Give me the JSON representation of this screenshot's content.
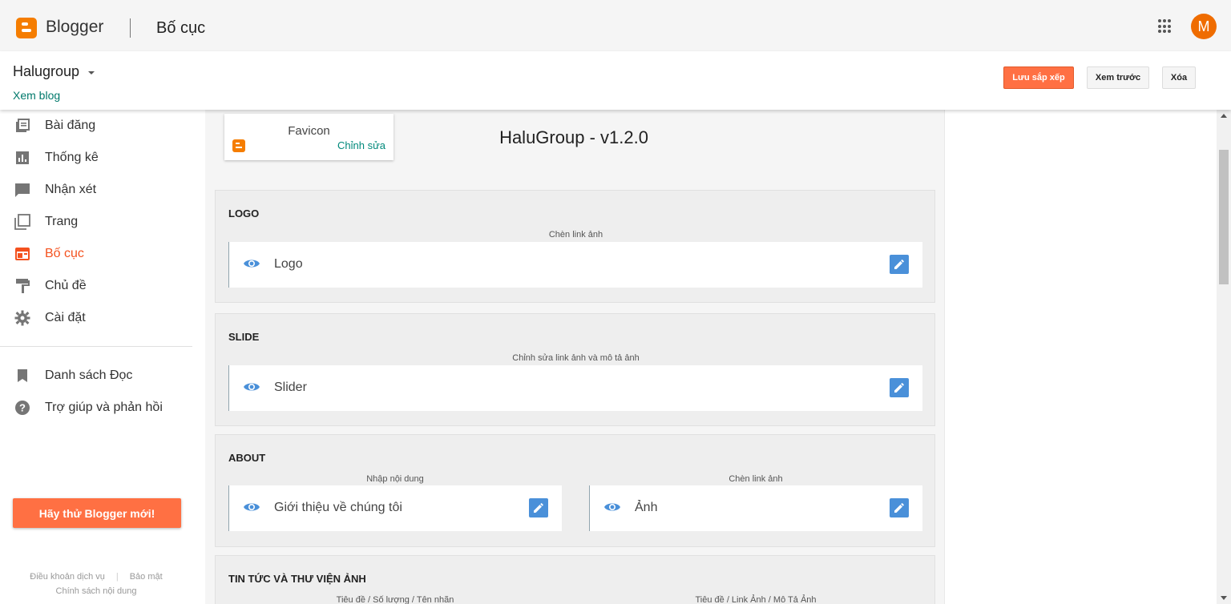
{
  "header": {
    "brand": "Blogger",
    "page_title": "Bố cục",
    "avatar_initial": "M",
    "apps_icon": "apps-grid-icon",
    "accent_color": "#f57d00"
  },
  "blog": {
    "name": "Halugroup",
    "view_link": "Xem blog"
  },
  "toolbar": {
    "save_label": "Lưu sắp xếp",
    "preview_label": "Xem trước",
    "delete_label": "Xóa"
  },
  "sidebar": {
    "items": [
      {
        "label": "Bài đăng",
        "icon": "posts-icon"
      },
      {
        "label": "Thống kê",
        "icon": "stats-icon"
      },
      {
        "label": "Nhận xét",
        "icon": "comments-icon"
      },
      {
        "label": "Trang",
        "icon": "pages-icon"
      },
      {
        "label": "Bố cục",
        "icon": "layout-icon",
        "active": true
      },
      {
        "label": "Chủ đề",
        "icon": "theme-icon"
      },
      {
        "label": "Cài đặt",
        "icon": "settings-icon"
      }
    ],
    "secondary_items": [
      {
        "label": "Danh sách Đọc",
        "icon": "bookmark-icon"
      },
      {
        "label": "Trợ giúp và phản hồi",
        "icon": "help-icon"
      }
    ],
    "try_button": "Hãy thử Blogger mới!",
    "footer": {
      "terms": "Điều khoản dịch vụ",
      "privacy": "Bảo mật",
      "content_policy": "Chính sách nội dung"
    }
  },
  "layout": {
    "favicon": {
      "title": "Favicon",
      "edit": "Chỉnh sửa"
    },
    "theme_title": "HaluGroup - v1.2.0",
    "sections": [
      {
        "title": "LOGO",
        "hint": "Chèn link ảnh",
        "gadget": "Logo"
      },
      {
        "title": "SLIDE",
        "hint": "Chỉnh sửa link ảnh và mô tả ảnh",
        "gadget": "Slider"
      },
      {
        "title": "ABOUT",
        "hints": [
          "Nhập nội dung",
          "Chèn link ảnh"
        ],
        "gadgets": [
          "Giới thiệu về chúng tôi",
          "Ảnh"
        ]
      },
      {
        "title": "TIN TỨC VÀ THƯ VIỆN ẢNH",
        "hints": [
          "Tiêu đề / Số lượng / Tên nhãn",
          "Tiêu đề / Link Ảnh / Mô Tả Ảnh"
        ]
      }
    ]
  }
}
